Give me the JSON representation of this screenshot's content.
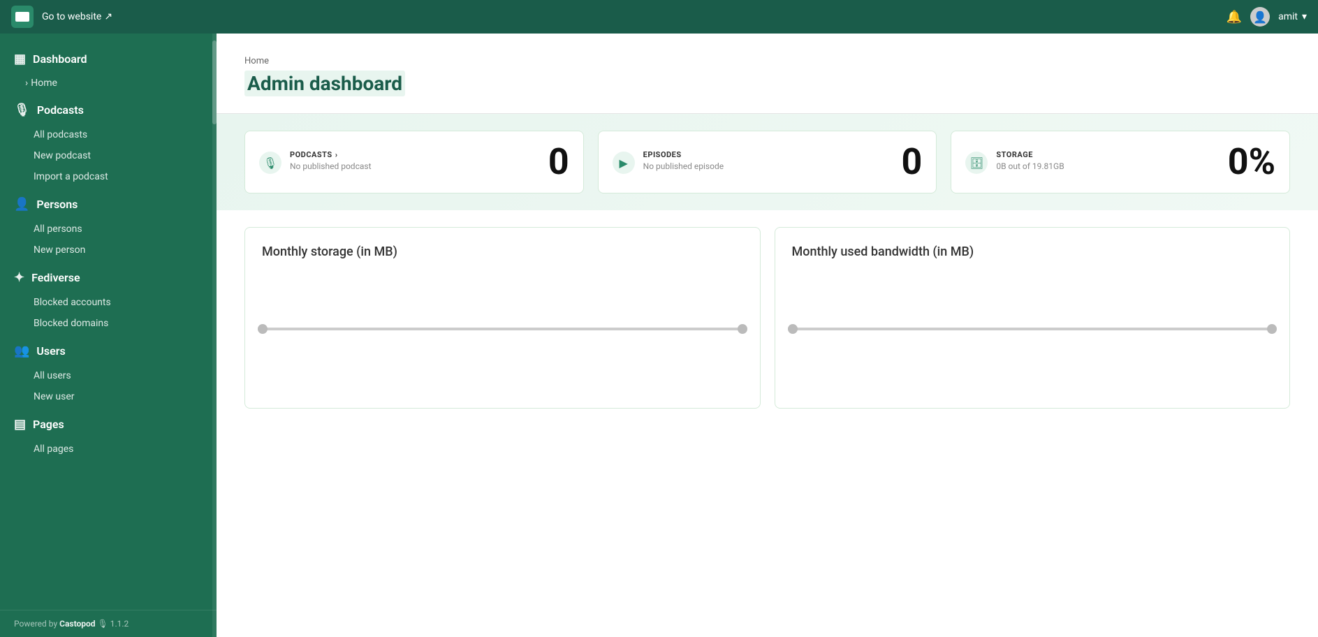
{
  "topbar": {
    "goto_label": "Go to website",
    "goto_icon": "external-link-icon",
    "logo_alt": "Castopod logo",
    "bell_icon": "bell-icon",
    "user_name": "amit",
    "chevron_icon": "chevron-down-icon",
    "avatar_icon": "account-circle-icon"
  },
  "sidebar": {
    "sections": [
      {
        "id": "dashboard",
        "label": "Dashboard",
        "icon": "dashboard-icon",
        "children": [
          {
            "id": "home",
            "label": "Home",
            "prefix": "›"
          }
        ]
      },
      {
        "id": "podcasts",
        "label": "Podcasts",
        "icon": "mic-icon",
        "children": [
          {
            "id": "all-podcasts",
            "label": "All podcasts"
          },
          {
            "id": "new-podcast",
            "label": "New podcast"
          },
          {
            "id": "import-podcast",
            "label": "Import a podcast"
          }
        ]
      },
      {
        "id": "persons",
        "label": "Persons",
        "icon": "person-icon",
        "children": [
          {
            "id": "all-persons",
            "label": "All persons"
          },
          {
            "id": "new-person",
            "label": "New person"
          }
        ]
      },
      {
        "id": "fediverse",
        "label": "Fediverse",
        "icon": "star-icon",
        "children": [
          {
            "id": "blocked-accounts",
            "label": "Blocked accounts"
          },
          {
            "id": "blocked-domains",
            "label": "Blocked domains"
          }
        ]
      },
      {
        "id": "users",
        "label": "Users",
        "icon": "users-icon",
        "children": [
          {
            "id": "all-users",
            "label": "All users"
          },
          {
            "id": "new-user",
            "label": "New user"
          }
        ]
      },
      {
        "id": "pages",
        "label": "Pages",
        "icon": "pages-icon",
        "children": [
          {
            "id": "all-pages",
            "label": "All pages"
          }
        ]
      }
    ],
    "footer": {
      "prefix": "Powered by",
      "brand": "Castopod",
      "version": "1.1.2"
    }
  },
  "main": {
    "breadcrumb": "Home",
    "page_title": "Admin dashboard",
    "stats": [
      {
        "id": "podcasts-stat",
        "label": "PODCASTS",
        "link_icon": "›",
        "sublabel": "No published podcast",
        "value": "0",
        "icon": "mic-icon"
      },
      {
        "id": "episodes-stat",
        "label": "EPISODES",
        "sublabel": "No published episode",
        "value": "0",
        "icon": "play-icon"
      },
      {
        "id": "storage-stat",
        "label": "STORAGE",
        "sublabel": "0B out of 19.81GB",
        "value": "0%",
        "icon": "storage-icon"
      }
    ],
    "charts": [
      {
        "id": "monthly-storage",
        "title": "Monthly storage (in MB)"
      },
      {
        "id": "monthly-bandwidth",
        "title": "Monthly used bandwidth (in MB)"
      }
    ]
  }
}
